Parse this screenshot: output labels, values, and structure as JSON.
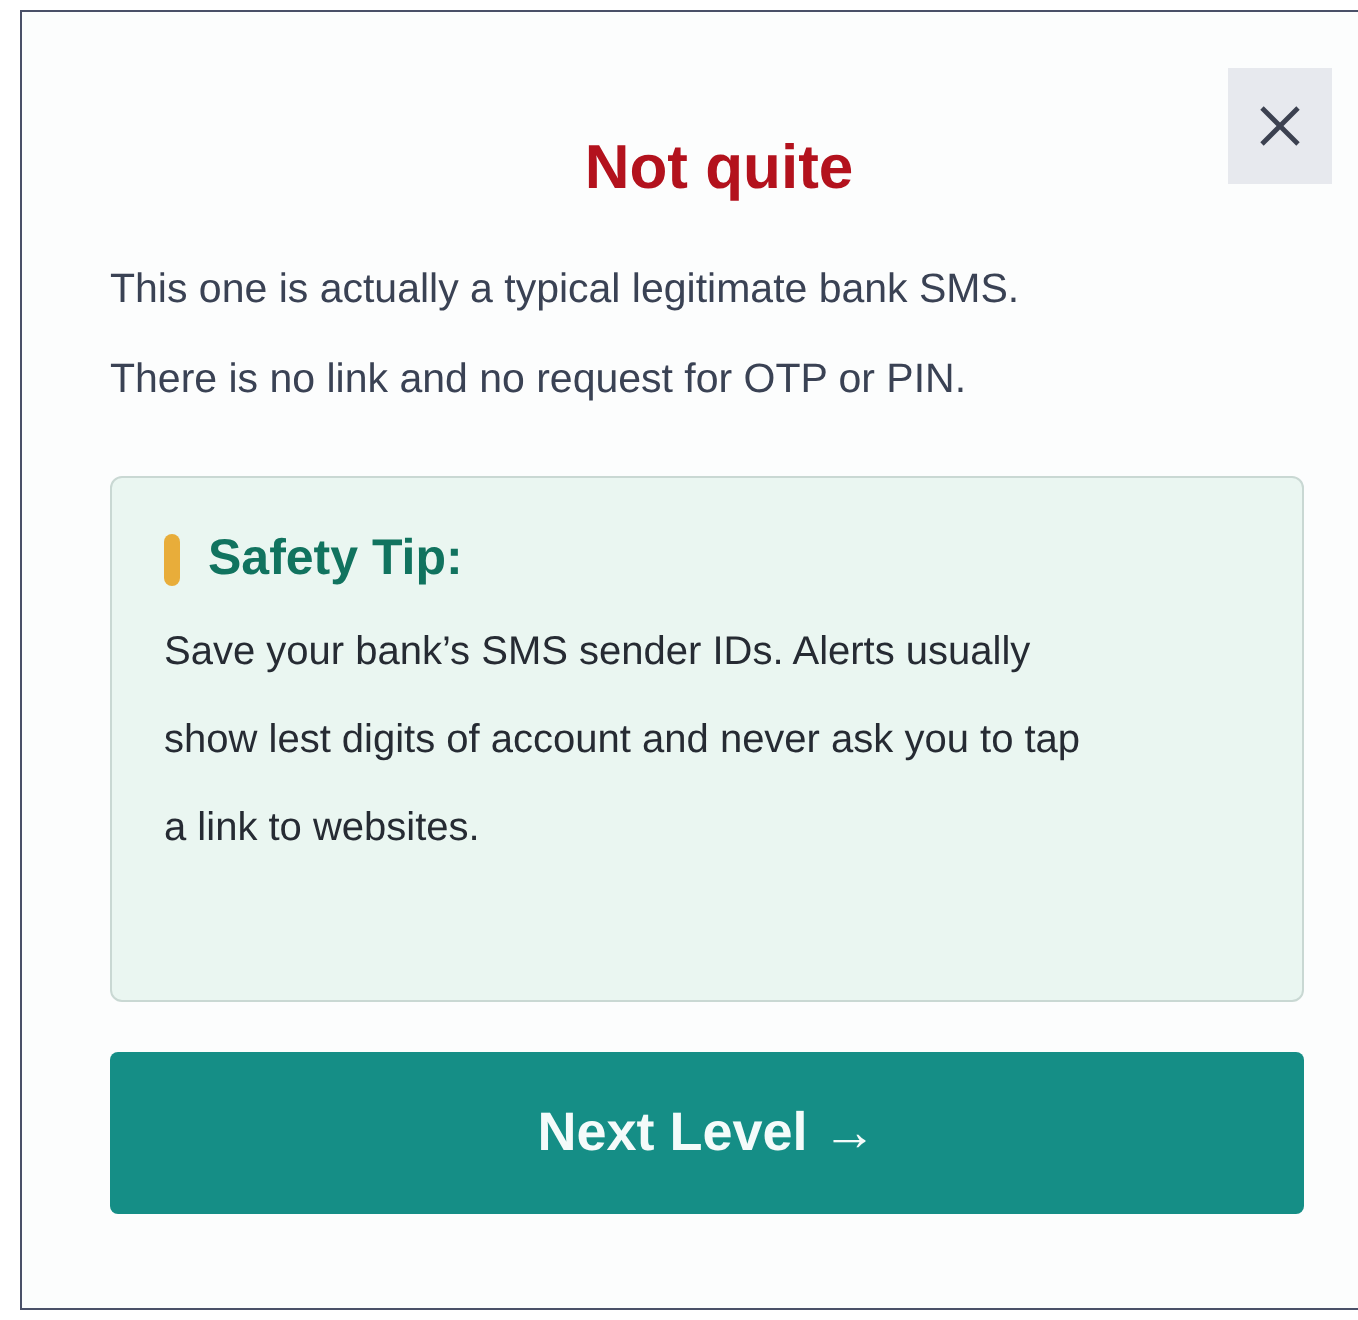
{
  "dialog": {
    "title": "Not quite",
    "message_lines": [
      "This one is actually a typical legitimate bank SMS.",
      "There is no link and no request for OTP or PIN."
    ],
    "tip": {
      "heading": "Safety Tip:",
      "body": "Save your bank’s SMS sender IDs. Alerts usually show lest digits of account and never ask you to tap a link to websites."
    },
    "primary_button": "Next Level →"
  }
}
